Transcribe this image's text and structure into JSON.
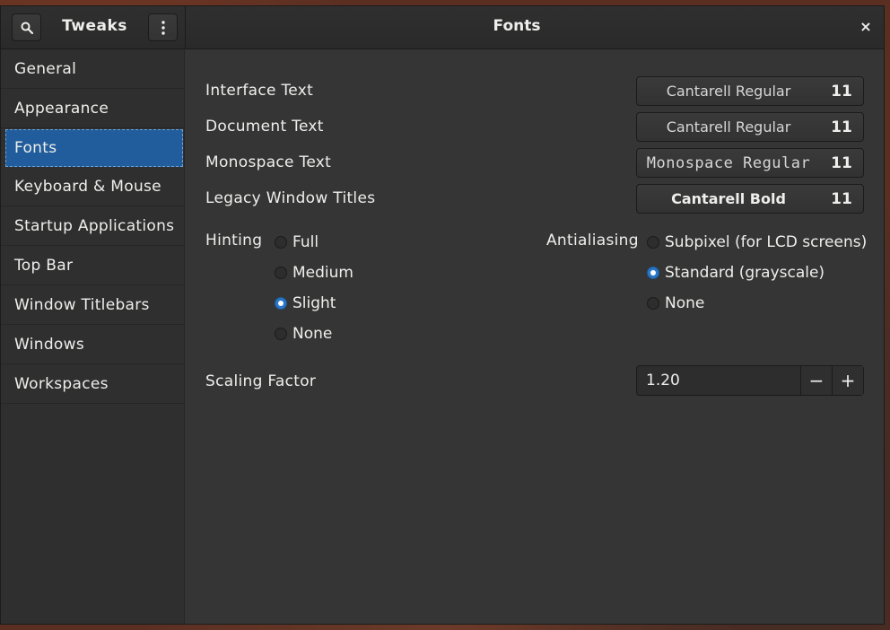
{
  "header": {
    "app_title": "Tweaks",
    "page_title": "Fonts",
    "close_glyph": "×",
    "search_icon": "search-icon",
    "menu_icon": "vertical-dots-icon"
  },
  "sidebar": {
    "items": [
      {
        "label": "General"
      },
      {
        "label": "Appearance"
      },
      {
        "label": "Fonts",
        "selected": true
      },
      {
        "label": "Keyboard & Mouse"
      },
      {
        "label": "Startup Applications"
      },
      {
        "label": "Top Bar"
      },
      {
        "label": "Window Titlebars"
      },
      {
        "label": "Windows"
      },
      {
        "label": "Workspaces"
      }
    ]
  },
  "fonts": {
    "interface": {
      "label": "Interface Text",
      "font": "Cantarell Regular",
      "size": "11"
    },
    "document": {
      "label": "Document Text",
      "font": "Cantarell Regular",
      "size": "11"
    },
    "monospace": {
      "label": "Monospace Text",
      "font": "Monospace Regular",
      "size": "11"
    },
    "legacy": {
      "label": "Legacy Window Titles",
      "font": "Cantarell Bold",
      "size": "11"
    }
  },
  "hinting": {
    "label": "Hinting",
    "options": [
      "Full",
      "Medium",
      "Slight",
      "None"
    ],
    "selected": "Slight"
  },
  "antialiasing": {
    "label": "Antialiasing",
    "options": [
      "Subpixel (for LCD screens)",
      "Standard (grayscale)",
      "None"
    ],
    "selected": "Standard (grayscale)"
  },
  "scaling": {
    "label": "Scaling Factor",
    "value": "1.20",
    "minus": "−",
    "plus": "+"
  },
  "colors": {
    "accent": "#215d9c",
    "radio_on": "#2a76c6"
  }
}
